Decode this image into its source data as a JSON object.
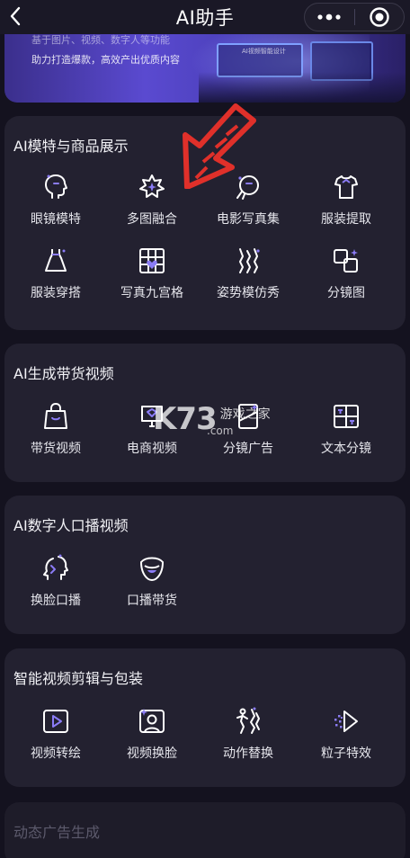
{
  "app": {
    "title": "AI助手"
  },
  "banner": {
    "line1": "基于图片、视频、数字人等功能",
    "line2": "助力打造爆款，高效产出优质内容",
    "screen_text": "AI视频智能设计"
  },
  "sections": [
    {
      "title": "AI模特与商品展示",
      "items": [
        {
          "label": "眼镜模特",
          "icon": "face-profile-icon"
        },
        {
          "label": "多图融合",
          "icon": "sparkle-burst-icon"
        },
        {
          "label": "电影写真集",
          "icon": "face-frame-icon"
        },
        {
          "label": "服装提取",
          "icon": "shirt-icon"
        },
        {
          "label": "服装穿搭",
          "icon": "dress-icon"
        },
        {
          "label": "写真九宫格",
          "icon": "grid-heart-icon"
        },
        {
          "label": "姿势模仿秀",
          "icon": "pose-icon"
        },
        {
          "label": "分镜图",
          "icon": "storyboard-icon"
        }
      ]
    },
    {
      "title": "AI生成带货视频",
      "items": [
        {
          "label": "带货视频",
          "icon": "shopping-bag-icon"
        },
        {
          "label": "电商视频",
          "icon": "ecommerce-icon"
        },
        {
          "label": "分镜广告",
          "icon": "split-ad-icon"
        },
        {
          "label": "文本分镜",
          "icon": "text-frame-icon"
        }
      ]
    },
    {
      "title": "AI数字人口播视频",
      "items": [
        {
          "label": "换脸口播",
          "icon": "face-swap-icon"
        },
        {
          "label": "口播带货",
          "icon": "mouth-icon"
        }
      ]
    },
    {
      "title": "智能视频剪辑与包装",
      "items": [
        {
          "label": "视频转绘",
          "icon": "play-frame-icon"
        },
        {
          "label": "视频换脸",
          "icon": "portrait-swap-icon"
        },
        {
          "label": "动作替换",
          "icon": "motion-icon"
        },
        {
          "label": "粒子特效",
          "icon": "particle-play-icon"
        }
      ]
    },
    {
      "title": "动态广告生成",
      "items": []
    }
  ],
  "watermark": {
    "logo": "K73",
    "text": "游戏之家",
    "sub": ".com"
  },
  "colors": {
    "background": "#14121f",
    "card": "#232130",
    "icon_stroke": "#ffffff",
    "icon_accent": "#8b7cf6",
    "arrow": "#e0302a"
  }
}
